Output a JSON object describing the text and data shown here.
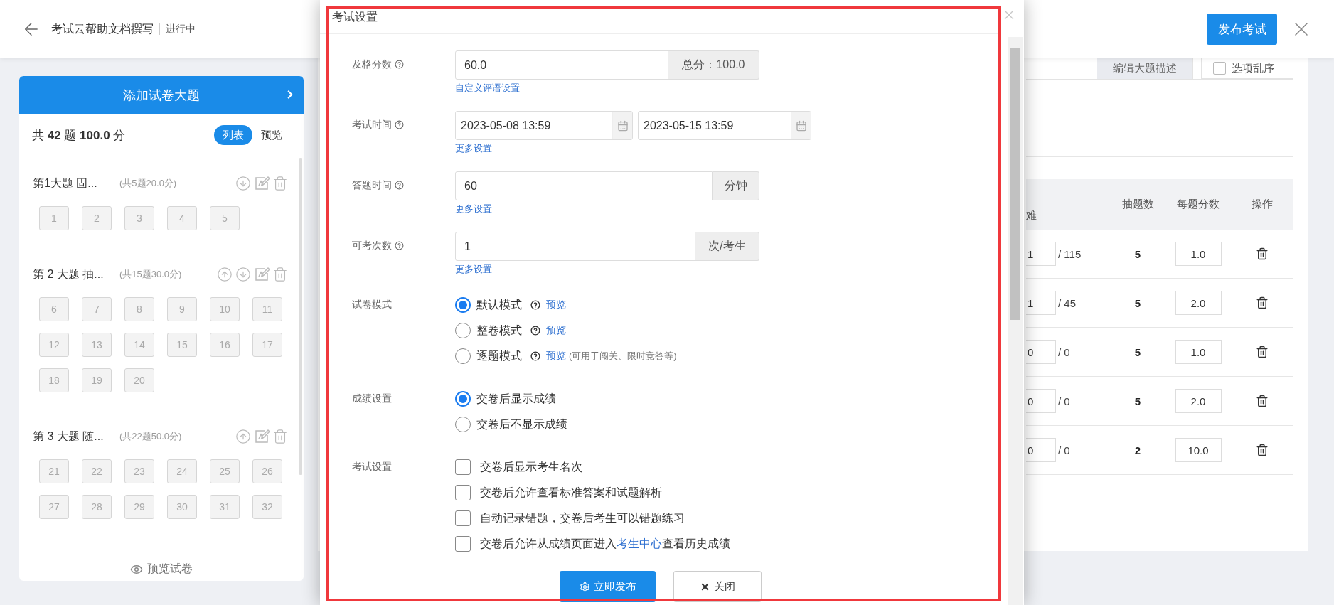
{
  "header": {
    "title": "考试云帮助文档撰写",
    "status": "进行中",
    "publish_button": "发布考试"
  },
  "sidebar": {
    "add_button": "添加试卷大题",
    "summary": "共 **42** 题 **100.0** 分",
    "view_tabs": [
      {
        "label": "列表",
        "selected": true
      },
      {
        "label": "预览",
        "selected": false
      }
    ],
    "sections": [
      {
        "title": "第1大题 固...",
        "info": "(共5题20.0分)",
        "can_move_up": false,
        "can_move_down": true,
        "questions": [
          "1",
          "2",
          "3",
          "4",
          "5"
        ]
      },
      {
        "title": "第 2 大题 抽...",
        "info": "(共15题30.0分)",
        "can_move_up": true,
        "can_move_down": true,
        "questions": [
          "6",
          "7",
          "8",
          "9",
          "10",
          "11",
          "12",
          "13",
          "14",
          "15",
          "16",
          "17",
          "18",
          "19",
          "20"
        ]
      },
      {
        "title": "第 3 大题 随...",
        "info": "(共22题50.0分)",
        "can_move_up": true,
        "can_move_down": false,
        "questions": [
          "21",
          "22",
          "23",
          "24",
          "25",
          "26",
          "27",
          "28",
          "29",
          "30",
          "31",
          "32"
        ]
      }
    ],
    "preview_button": "预览试卷"
  },
  "main": {
    "toolbar": [
      {
        "kind": "button",
        "label": "编辑大题描述"
      },
      {
        "kind": "checkbox",
        "label": "选项乱序",
        "checked": false
      }
    ],
    "table": {
      "columns": [
        "难",
        "抽题数",
        "每题分数",
        "操作"
      ],
      "rows": [
        {
          "available": "1",
          "total": "/ 115",
          "draw": "5",
          "score": "1.0"
        },
        {
          "available": "1",
          "total": "/ 45",
          "draw": "5",
          "score": "2.0"
        },
        {
          "available": "0",
          "total": "/ 0",
          "draw": "5",
          "score": "1.0"
        },
        {
          "available": "0",
          "total": "/ 0",
          "draw": "5",
          "score": "2.0"
        },
        {
          "available": "0",
          "total": "/ 0",
          "draw": "2",
          "score": "10.0"
        }
      ]
    }
  },
  "dialog": {
    "title": "考试设置",
    "fields": [
      {
        "kind": "input",
        "label": "及格分数",
        "help": true,
        "value": "60.0",
        "addon": "总分：100.0",
        "link": "自定义评语设置"
      },
      {
        "kind": "date_range",
        "label": "考试时间",
        "help": true,
        "values": [
          "2023-05-08 13:59",
          "2023-05-15 13:59"
        ],
        "link": "更多设置"
      },
      {
        "kind": "input",
        "label": "答题时间",
        "help": true,
        "value": "60",
        "addon": "分钟",
        "link": "更多设置"
      },
      {
        "kind": "input",
        "label": "可考次数",
        "help": true,
        "value": "1",
        "addon": "次/考生",
        "link": "更多设置"
      },
      {
        "kind": "radio",
        "label": "试卷模式",
        "options": [
          {
            "label": "默认模式",
            "selected": true,
            "help": true,
            "link": "预览"
          },
          {
            "label": "整卷模式",
            "selected": false,
            "help": true,
            "link": "预览"
          },
          {
            "label": "逐题模式",
            "selected": false,
            "help": true,
            "link": "预览",
            "note": "(可用于闯关、限时竞答等)"
          }
        ]
      },
      {
        "kind": "radio",
        "label": "成绩设置",
        "options": [
          {
            "label": "交卷后显示成绩",
            "selected": true
          },
          {
            "label": "交卷后不显示成绩",
            "selected": false
          }
        ]
      },
      {
        "kind": "checkbox",
        "label": "考试设置",
        "options": [
          {
            "label": "交卷后显示考生名次",
            "checked": false
          },
          {
            "label": "交卷后允许查看标准答案和试题解析",
            "checked": false
          },
          {
            "label": "自动记录错题，交卷后考生可以错题练习",
            "checked": false
          },
          {
            "label": "交卷后允许从成绩页面进入",
            "link": "考生中心",
            "after": "查看历史成绩",
            "checked": false
          }
        ]
      }
    ],
    "buttons": [
      {
        "kind": "primary",
        "label": "立即发布"
      },
      {
        "kind": "default",
        "label": "关闭"
      }
    ]
  }
}
